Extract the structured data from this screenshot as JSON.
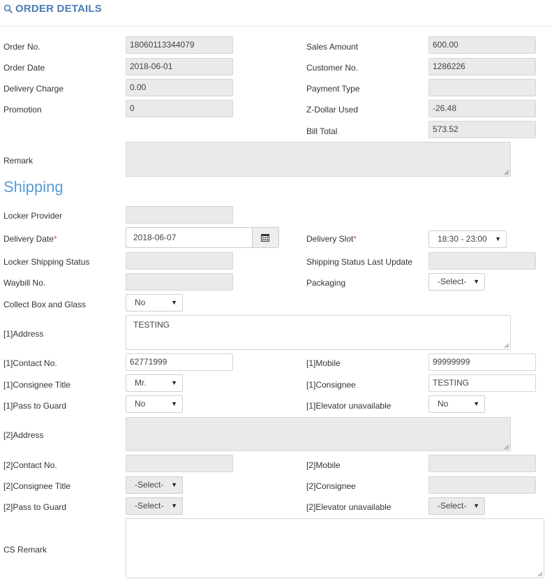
{
  "header": {
    "title": "ORDER DETAILS"
  },
  "order": {
    "order_no_label": "Order No.",
    "order_no": "18060113344079",
    "order_date_label": "Order Date",
    "order_date": "2018-06-01",
    "delivery_charge_label": "Delivery Charge",
    "delivery_charge": "0.00",
    "promotion_label": "Promotion",
    "promotion": "0",
    "sales_amount_label": "Sales Amount",
    "sales_amount": "600.00",
    "customer_no_label": "Customer No.",
    "customer_no": "1286226",
    "payment_type_label": "Payment Type",
    "payment_type": "",
    "zdollar_label": "Z-Dollar Used",
    "zdollar": "-26.48",
    "bill_total_label": "Bill Total",
    "bill_total": "573.52",
    "remark_label": "Remark",
    "remark": ""
  },
  "shipping": {
    "section_title": "Shipping",
    "locker_provider_label": "Locker Provider",
    "locker_provider": "",
    "delivery_date_label": "Delivery Date",
    "delivery_date": "2018-06-07",
    "delivery_slot_label": "Delivery Slot",
    "delivery_slot": "18:30 - 23:00",
    "required_mark": "*",
    "locker_status_label": "Locker Shipping Status",
    "locker_status": "",
    "status_update_label": "Shipping Status Last Update",
    "status_update": "",
    "waybill_label": "Waybill No.",
    "waybill": "",
    "packaging_label": "Packaging",
    "packaging": "-Select-",
    "collect_box_label": "Collect Box and Glass",
    "collect_box": "No",
    "addr1_label": "[1]Address",
    "addr1": "TESTING",
    "contact1_label": "[1]Contact No.",
    "contact1": "62771999",
    "mobile1_label": "[1]Mobile",
    "mobile1": "99999999",
    "title1_label": "[1]Consignee Title",
    "title1": "Mr.",
    "consignee1_label": "[1]Consignee",
    "consignee1": "TESTING",
    "guard1_label": "[1]Pass to Guard",
    "guard1": "No",
    "elevator1_label": "[1]Elevator unavailable",
    "elevator1": "No",
    "addr2_label": "[2]Address",
    "addr2": "",
    "contact2_label": "[2]Contact No.",
    "contact2": "",
    "mobile2_label": "[2]Mobile",
    "mobile2": "",
    "title2_label": "[2]Consignee Title",
    "title2": "-Select-",
    "consignee2_label": "[2]Consignee",
    "consignee2": "",
    "guard2_label": "[2]Pass to Guard",
    "guard2": "-Select-",
    "elevator2_label": "[2]Elevator unavailable",
    "elevator2": "-Select-",
    "cs_remark_label": "CS Remark",
    "cs_remark": ""
  },
  "icons": {
    "header": "search-icon",
    "date": "calendar-icon",
    "dropdown": "caret-down-icon",
    "resize": "resize-grip-icon"
  },
  "colors": {
    "accent": "#4a7cb6",
    "section": "#5b9bd5",
    "required": "#d9534f",
    "readonly_bg": "#eaeaea"
  }
}
